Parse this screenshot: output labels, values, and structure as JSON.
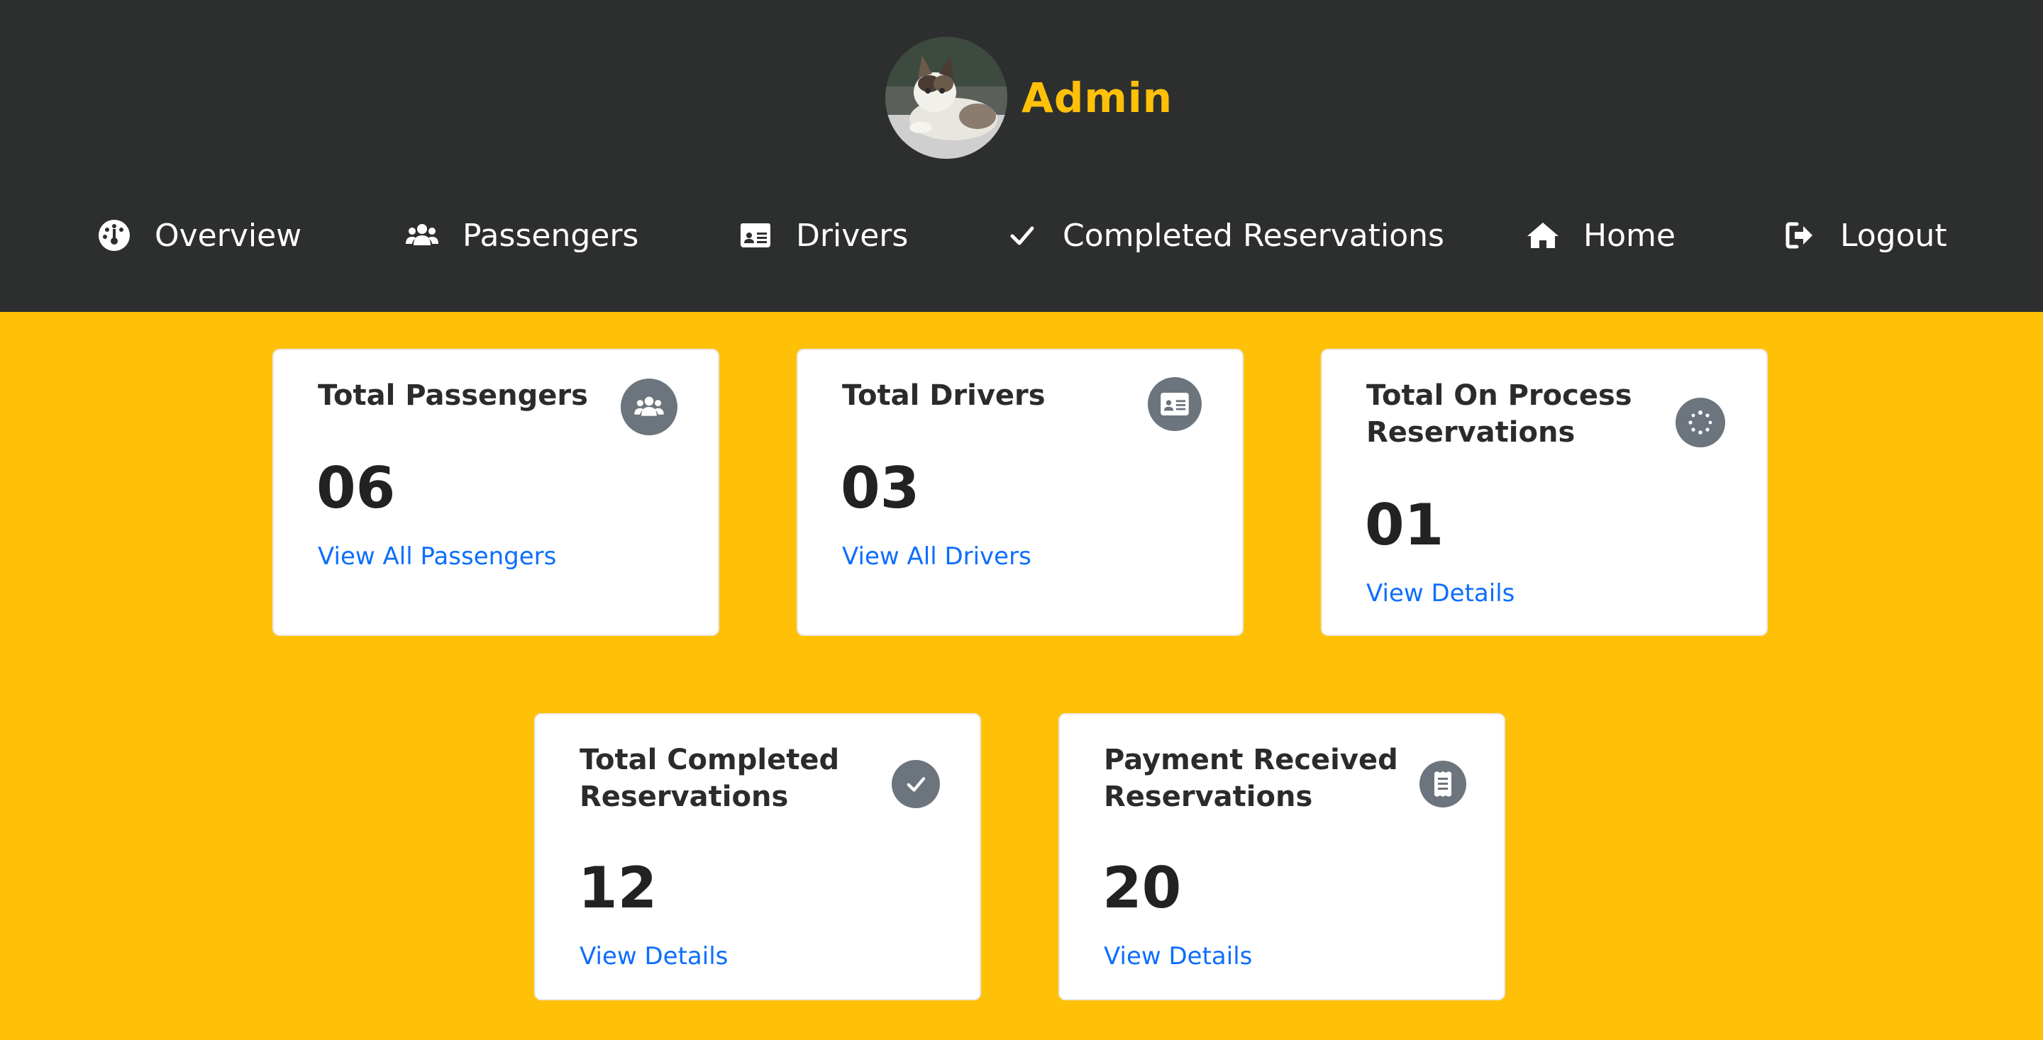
{
  "header": {
    "admin_name": "Admin",
    "background": "#2d2f2f",
    "accent": "#ffc107"
  },
  "nav": [
    {
      "label": "Overview",
      "icon": "dashboard-gauge-icon"
    },
    {
      "label": "Passengers",
      "icon": "users-icon"
    },
    {
      "label": "Drivers",
      "icon": "id-card-icon"
    },
    {
      "label": "Completed Reservations",
      "icon": "check-icon"
    },
    {
      "label": "Home",
      "icon": "home-icon"
    },
    {
      "label": "Logout",
      "icon": "logout-icon"
    }
  ],
  "cards": [
    {
      "title": "Total Passengers",
      "value": "06",
      "link": "View All Passengers",
      "icon": "users-icon"
    },
    {
      "title": "Total Drivers",
      "value": "03",
      "link": "View All Drivers",
      "icon": "id-card-icon"
    },
    {
      "title": "Total On Process Reservations",
      "value": "01",
      "link": "View Details",
      "icon": "spinner-icon"
    },
    {
      "title": "Total Completed Reservations",
      "value": "12",
      "link": "View Details",
      "icon": "check-icon"
    },
    {
      "title": "Payment Received Reservations",
      "value": "20",
      "link": "View Details",
      "icon": "receipt-icon"
    }
  ],
  "colors": {
    "main_background": "#ffc107",
    "card_icon_background": "#6c757d",
    "link": "#0d6efd"
  }
}
